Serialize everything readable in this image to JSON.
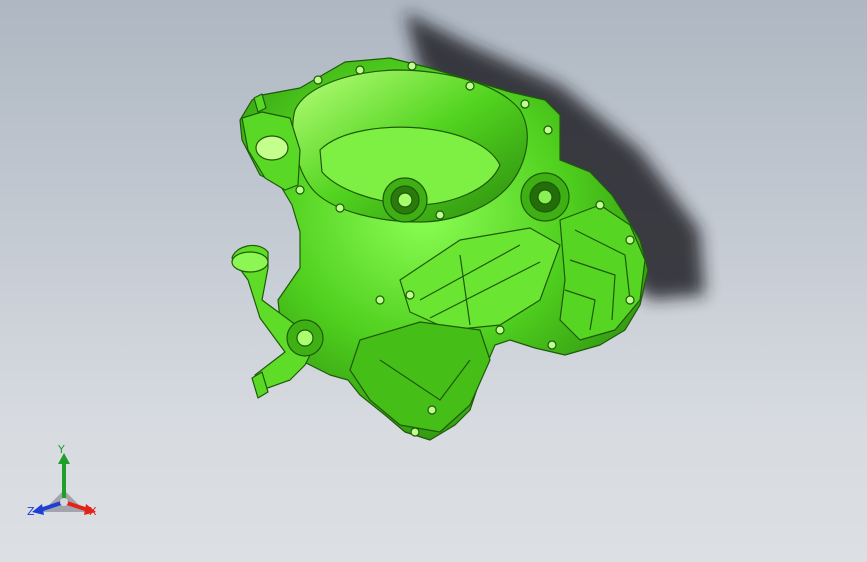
{
  "viewport": {
    "background_top": "#aeb7c2",
    "background_bottom": "#dcdfe3"
  },
  "model": {
    "part_color": "#4fcf1e",
    "edge_color": "#1f5a0b",
    "shadow_color": "#1c1e22"
  },
  "triad": {
    "x_label": "X",
    "y_label": "Y",
    "z_label": "Z",
    "x_color": "#e2231a",
    "y_color": "#1f9e2a",
    "z_color": "#1d3fd6"
  }
}
